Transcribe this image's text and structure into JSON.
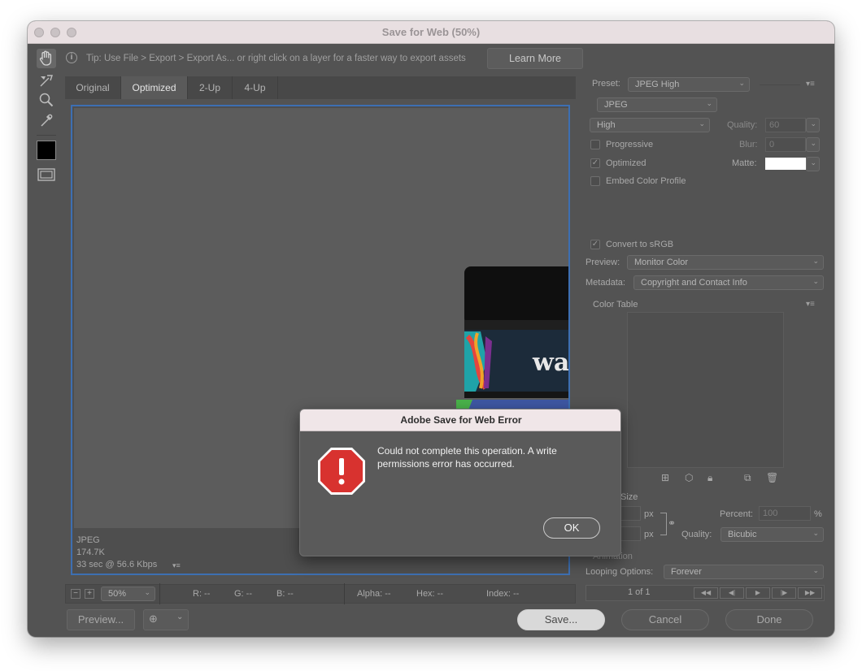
{
  "window": {
    "title": "Save for Web (50%)"
  },
  "tipbar": {
    "tip": "Tip: Use File > Export > Export As...  or right click on a layer for a faster way to export assets",
    "learn_more": "Learn More"
  },
  "tabs": [
    "Original",
    "Optimized",
    "2-Up",
    "4-Up"
  ],
  "active_tab": "Optimized",
  "image_info": {
    "format": "JPEG",
    "size": "174.7K",
    "time": "33 sec @ 56.6 Kbps"
  },
  "status_bar": {
    "zoom": "50%",
    "r": "R: --",
    "g": "G: --",
    "b": "B: --",
    "alpha": "Alpha: --",
    "hex": "Hex: --",
    "index": "Index: --"
  },
  "bottom": {
    "preview": "Preview...",
    "save": "Save...",
    "cancel": "Cancel",
    "done": "Done"
  },
  "settings": {
    "preset_label": "Preset:",
    "preset": "JPEG High",
    "format": "JPEG",
    "quality_preset": "High",
    "quality_label": "Quality:",
    "quality": "60",
    "progressive": "Progressive",
    "blur_label": "Blur:",
    "blur": "0",
    "optimized": "Optimized",
    "matte_label": "Matte:",
    "embed_color_profile": "Embed Color Profile",
    "convert_srgb": "Convert to sRGB",
    "preview_label": "Preview:",
    "preview": "Monitor Color",
    "metadata_label": "Metadata:",
    "metadata": "Copyright and Contact Info",
    "color_table": "Color Table",
    "image_size": "Size",
    "px1": "px",
    "px2": "px",
    "percent_label": "Percent:",
    "percent": "100",
    "percent_sign": "%",
    "size_quality_label": "Quality:",
    "size_quality": "Bicubic",
    "animation": "Animation",
    "looping_label": "Looping Options:",
    "looping": "Forever",
    "frame_counter": "1 of 1"
  },
  "product": {
    "jar_text": "wa"
  },
  "dialog": {
    "title": "Adobe Save for Web Error",
    "message": "Could not complete this operation. A write\npermissions error has occurred.",
    "ok": "OK"
  },
  "colors": {
    "selection_border": "#3d6fb2",
    "error_red": "#d63a3a",
    "panel": "#535353"
  }
}
